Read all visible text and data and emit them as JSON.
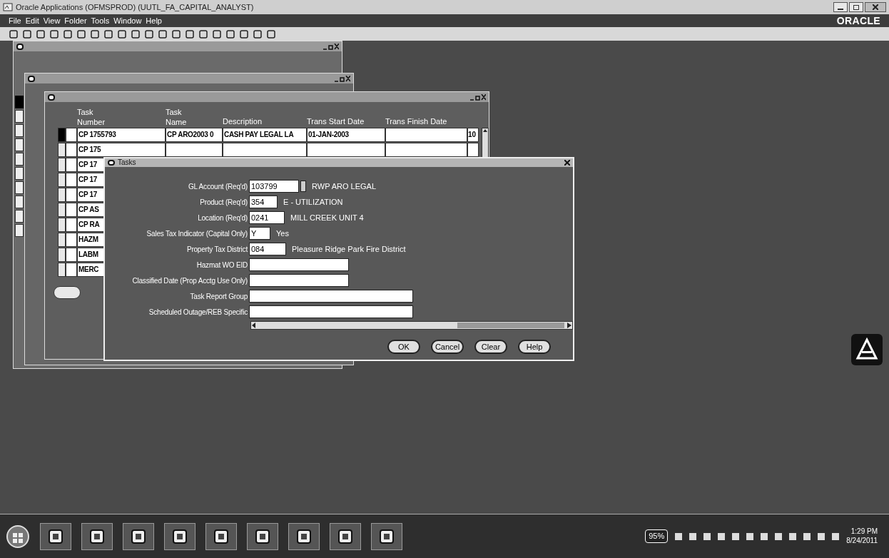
{
  "window": {
    "title": "Oracle Applications (OFMSPROD) (UUTL_FA_CAPITAL_ANALYST)"
  },
  "menu": [
    "File",
    "Edit",
    "View",
    "Folder",
    "Tools",
    "Window",
    "Help"
  ],
  "logo": "ORACLE",
  "task_list": {
    "columns": [
      {
        "line1": "Task",
        "line2": "Number"
      },
      {
        "line1": "Task",
        "line2": "Name"
      },
      {
        "line2": "Description"
      },
      {
        "line2": "Trans Start Date"
      },
      {
        "line2": "Trans Finish Date"
      }
    ],
    "rows": [
      {
        "selected": true,
        "task_number": "CP 1755793",
        "task_name": "CP ARO2003 0",
        "description": "CASH PAY LEGAL LA",
        "trans_start_date": "01-JAN-2003",
        "column_6": "10"
      },
      {
        "selected": false,
        "task_number": "CP 175"
      },
      {
        "selected": false,
        "task_number": "CP 17"
      },
      {
        "selected": false,
        "task_number": "CP 17"
      },
      {
        "selected": false,
        "task_number": "CP 17"
      },
      {
        "selected": false,
        "task_number": "CP AS"
      },
      {
        "selected": false,
        "task_number": "CP RA"
      },
      {
        "selected": false,
        "task_number": "HAZM"
      },
      {
        "selected": false,
        "task_number": "LABM"
      },
      {
        "selected": false,
        "task_number": "MERC"
      }
    ]
  },
  "dialog": {
    "title": "Tasks",
    "fields": [
      {
        "label": "GL Account (Req'd)",
        "value": "103799",
        "description": "RWP ARO LEGAL"
      },
      {
        "label": "Product (Req'd)",
        "value": "354",
        "description": "E - UTILIZATION"
      },
      {
        "label": "Location (Req'd)",
        "value": "0241",
        "description": "MILL CREEK UNIT 4"
      },
      {
        "label": "Sales Tax Indicator (Capital Only)",
        "value": "Y",
        "description": "Yes"
      },
      {
        "label": "Property Tax District",
        "value": "084",
        "description": "Pleasure Ridge Park Fire District"
      },
      {
        "label": "Hazmat WO EID"
      },
      {
        "label": "Classified Date (Prop Acctg Use Only)"
      },
      {
        "label": "Task Report Group"
      },
      {
        "label": "Scheduled Outage/REB Specific"
      }
    ],
    "buttons": [
      "OK",
      "Cancel",
      "Clear",
      "Help"
    ]
  },
  "tray": {
    "battery": "95%",
    "time": "1:29 PM",
    "date": "8/24/2011"
  }
}
